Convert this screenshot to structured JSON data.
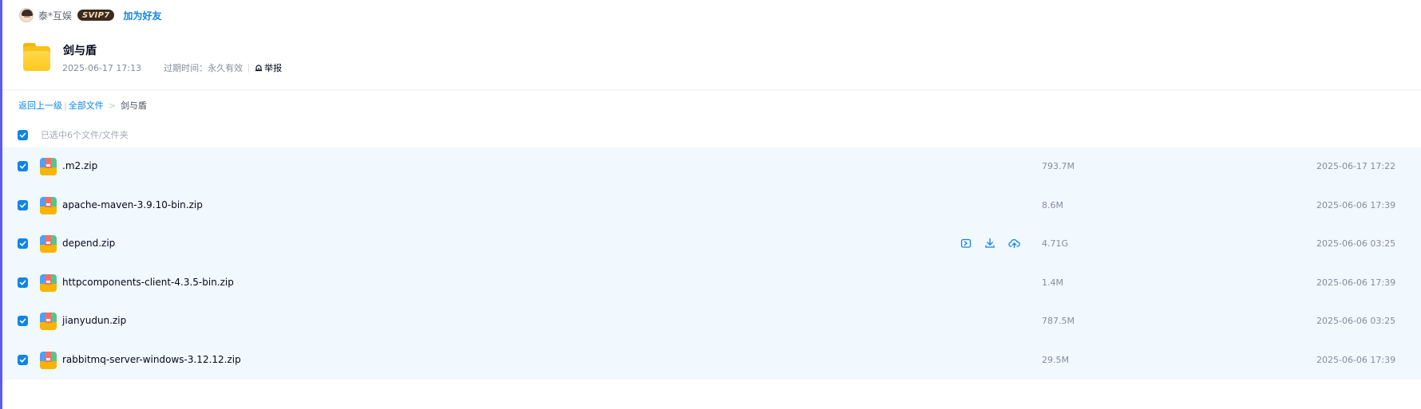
{
  "share": {
    "user_name": "泰*互娱",
    "vip_badge": "SVIP7",
    "add_friend": "加为好友",
    "title": "剑与盾",
    "date": "2025-06-17 17:13",
    "expire_label": "过期时间：永久有效",
    "report": "举报"
  },
  "breadcrumb": {
    "back": "返回上一级",
    "all_files": "全部文件",
    "separator_1": "|",
    "separator_2": ">",
    "current": "剑与盾"
  },
  "selection": {
    "summary": "已选中6个文件/文件夹",
    "select_all_checked": true
  },
  "files": [
    {
      "name": ".m2.zip",
      "size": "793.7M",
      "date": "2025-06-17 17:22",
      "checked": true
    },
    {
      "name": "apache-maven-3.9.10-bin.zip",
      "size": "8.6M",
      "date": "2025-06-06 17:39",
      "checked": true
    },
    {
      "name": "depend.zip",
      "size": "4.71G",
      "date": "2025-06-06 03:25",
      "checked": true,
      "hovered": true
    },
    {
      "name": "httpcomponents-client-4.3.5-bin.zip",
      "size": "1.4M",
      "date": "2025-06-06 17:39",
      "checked": true
    },
    {
      "name": "jianyudun.zip",
      "size": "787.5M",
      "date": "2025-06-06 03:25",
      "checked": true
    },
    {
      "name": "rabbitmq-server-windows-3.12.12.zip",
      "size": "29.5M",
      "date": "2025-06-06 17:39",
      "checked": true
    }
  ],
  "row_actions": [
    "save-to-drive-icon",
    "download-icon",
    "cloud-upload-icon"
  ],
  "colors": {
    "accent": "#0d85e8",
    "selected_row_bg": "#f1f8fe",
    "muted_text": "#878c9c",
    "folder_yellow": "#ffc81e"
  }
}
